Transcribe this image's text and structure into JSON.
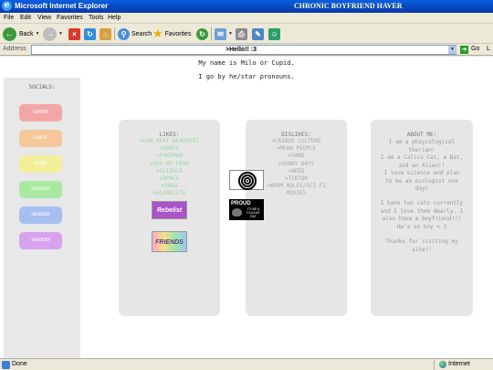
{
  "window": {
    "app_title": "Microsoft Internet Explorer",
    "page_title": "CHRONIC BOYFRIEND HAVER"
  },
  "menu": [
    "File",
    "Edit",
    "View",
    "Favorites",
    "Tools",
    "Help"
  ],
  "toolbar": {
    "back_label": "Back",
    "search_label": "Search",
    "favorites_label": "Favorites"
  },
  "address": {
    "label": "Address",
    "value": ">Hello!! :3",
    "go_label": "Go",
    "links_label": "L"
  },
  "intro": {
    "line1": "My name is Milo or Cupid.",
    "line2": "I go by he/star pronouns."
  },
  "socials": {
    "heading": "SOCIALS:",
    "buttons": [
      {
        "label": "tumblr",
        "color": "#f4a6a6"
      },
      {
        "label": "carrd",
        "color": "#f5c79b"
      },
      {
        "label": "insta",
        "color": "#f2ef9a"
      },
      {
        "label": "random",
        "color": "#a9e8a0"
      },
      {
        "label": "random",
        "color": "#a7bff0"
      },
      {
        "label": "random",
        "color": "#d8a3ee"
      }
    ]
  },
  "likes": {
    "heading": "LIKES:",
    "items": [
      ">CAR SEAT HEADREST",
      ">SONIC",
      ">POKEMON",
      ">CRY OF FEAR",
      ">SCIENCE",
      ">SPACE",
      ">SODA",
      ">GLIMECITE"
    ]
  },
  "dislikes": {
    "heading": "DISLIKES:",
    "items": [
      ">CRINGE CULTURE",
      ">MEAN PEOPLE",
      ">SAND",
      ">SUNNY DAYS",
      ">WEED",
      ">TIKTOK",
      ">WORM HOLES/SCI FI",
      "MOVIES"
    ]
  },
  "about": {
    "heading": "ABOUT ME:",
    "paragraphs": [
      "I am a phsycological therian!",
      "I am a Calico Cat, a Bat, and an Alien!!",
      "I love science and plan to be an ecologist one day!",
      "I have two cats currently and I love them dearly. I also have a boyfriend!!! He's so boy < 3",
      "Thanks for visiting my site!!"
    ]
  },
  "stamps": {
    "stamp1": "Rebelist",
    "stamp2": "FRIENDS",
    "proud_line1": "PROUD",
    "proud_line2": "TO BE A PLAGUE RAT"
  },
  "status": {
    "text": "Done",
    "zone": "Internet"
  }
}
